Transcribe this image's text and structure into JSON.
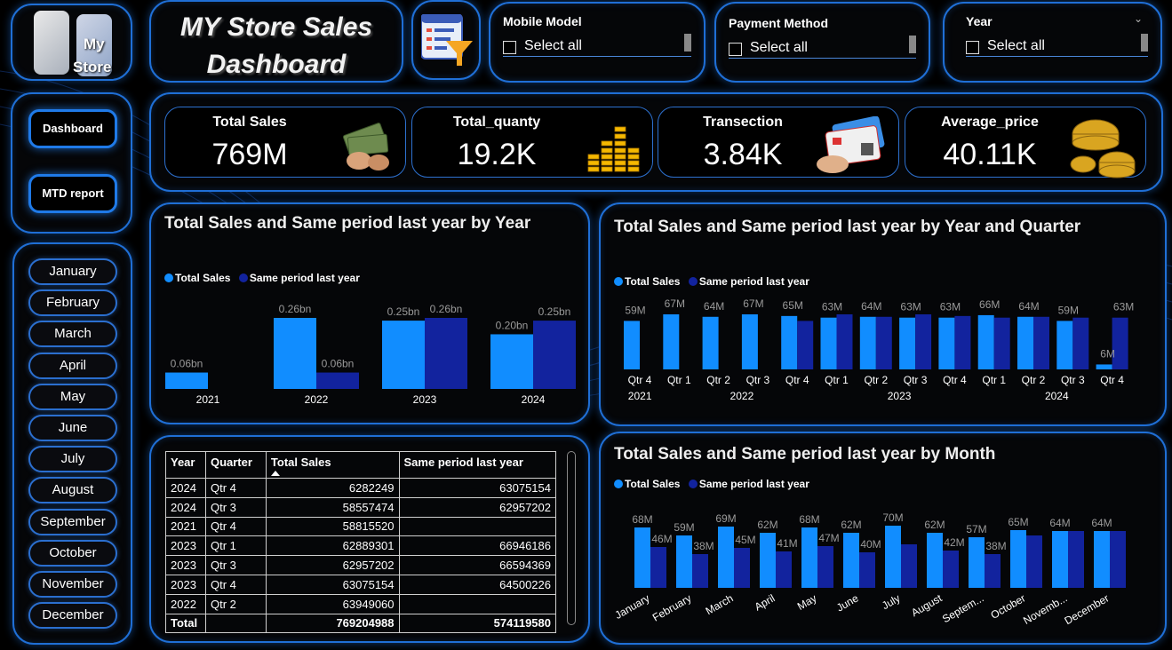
{
  "logo": {
    "text_line1": "My",
    "text_line2": "Store"
  },
  "header": {
    "title_line1": "MY Store Sales",
    "title_line2": "Dashboard"
  },
  "nav": {
    "dashboard": "Dashboard",
    "mtd_report": "MTD report"
  },
  "months": [
    "January",
    "February",
    "March",
    "April",
    "May",
    "June",
    "July",
    "August",
    "September",
    "October",
    "November",
    "December"
  ],
  "slicers": [
    {
      "title": "Mobile Model",
      "option": "Select all"
    },
    {
      "title": "Payment Method",
      "option": "Select all"
    },
    {
      "title": "Year",
      "option": "Select all"
    }
  ],
  "kpis": [
    {
      "label": "Total Sales",
      "value": "769M",
      "icon": "cash-icon"
    },
    {
      "label": "Total_quanty",
      "value": "19.2K",
      "icon": "coin-stack-chart-icon"
    },
    {
      "label": "Transection",
      "value": "3.84K",
      "icon": "credit-card-icon"
    },
    {
      "label": "Average_price",
      "value": "40.11K",
      "icon": "gold-coins-icon"
    }
  ],
  "legend": {
    "series1": "Total Sales",
    "series2": "Same period last year"
  },
  "colors": {
    "series1": "#118dff",
    "series2": "#12239e",
    "accent": "#1f6fd6"
  },
  "charts": {
    "by_year_title": "Total Sales and Same period last year by Year",
    "by_quarter_title": "Total Sales and Same period last year by Year and Quarter",
    "by_month_title": "Total Sales and Same period last year by Month"
  },
  "chart_data": [
    {
      "type": "bar",
      "title": "Total Sales and Same period last year by Year",
      "categories": [
        "2021",
        "2022",
        "2023",
        "2024"
      ],
      "series": [
        {
          "name": "Total Sales",
          "values": [
            0.06,
            0.26,
            0.25,
            0.2
          ],
          "labels": [
            "0.06bn",
            "0.26bn",
            "0.25bn",
            "0.20bn"
          ]
        },
        {
          "name": "Same period last year",
          "values": [
            null,
            0.06,
            0.26,
            0.25
          ],
          "labels": [
            "",
            "0.06bn",
            "0.26bn",
            "0.25bn"
          ]
        }
      ],
      "ylim": [
        0,
        0.26
      ]
    },
    {
      "type": "bar",
      "title": "Total Sales and Same period last year by Year and Quarter",
      "categories": [
        "Qtr 4",
        "Qtr 1",
        "Qtr 2",
        "Qtr 3",
        "Qtr 4",
        "Qtr 1",
        "Qtr 2",
        "Qtr 3",
        "Qtr 4",
        "Qtr 1",
        "Qtr 2",
        "Qtr 3",
        "Qtr 4"
      ],
      "groups": [
        {
          "label": "2021",
          "span": 1
        },
        {
          "label": "2022",
          "span": 4
        },
        {
          "label": "2023",
          "span": 4
        },
        {
          "label": "2024",
          "span": 4
        }
      ],
      "series": [
        {
          "name": "Total Sales",
          "values": [
            59,
            67,
            64,
            67,
            65,
            63,
            64,
            63,
            63,
            66,
            64,
            59,
            6
          ]
        },
        {
          "name": "Same period last year",
          "values": [
            null,
            null,
            null,
            null,
            59,
            67,
            64,
            67,
            65,
            63,
            64,
            63,
            63
          ]
        }
      ],
      "labels": [
        "59M",
        "67M",
        "64M",
        "67M",
        "65M",
        "63M",
        "64M",
        "63M",
        "63M",
        "66M",
        "64M",
        "59M",
        "6M",
        "63M"
      ],
      "ylim": [
        0,
        67
      ]
    },
    {
      "type": "bar",
      "title": "Total Sales and Same period last year by Month",
      "categories": [
        "January",
        "February",
        "March",
        "April",
        "May",
        "June",
        "July",
        "August",
        "Septem...",
        "October",
        "Novemb...",
        "December"
      ],
      "series": [
        {
          "name": "Total Sales",
          "values": [
            68,
            59,
            69,
            62,
            68,
            62,
            70,
            62,
            57,
            65,
            64,
            64
          ],
          "labels": [
            "68M",
            "59M",
            "69M",
            "62M",
            "68M",
            "62M",
            "70M",
            "62M",
            "57M",
            "65M",
            "64M",
            "64M"
          ]
        },
        {
          "name": "Same period last year",
          "values": [
            46,
            38,
            45,
            41,
            47,
            40,
            49,
            42,
            38,
            59,
            64,
            64
          ],
          "labels": [
            "46M",
            "38M",
            "45M",
            "41M",
            "47M",
            "40M",
            "",
            "42M",
            "38M",
            "",
            "",
            ""
          ]
        }
      ],
      "ylim": [
        0,
        70
      ]
    }
  ],
  "table": {
    "headers": [
      "Year",
      "Quarter",
      "Total Sales",
      "Same period last year"
    ],
    "rows": [
      [
        "2024",
        "Qtr 4",
        "6282249",
        "63075154"
      ],
      [
        "2024",
        "Qtr 3",
        "58557474",
        "62957202"
      ],
      [
        "2021",
        "Qtr 4",
        "58815520",
        ""
      ],
      [
        "2023",
        "Qtr 1",
        "62889301",
        "66946186"
      ],
      [
        "2023",
        "Qtr 3",
        "62957202",
        "66594369"
      ],
      [
        "2023",
        "Qtr 4",
        "63075154",
        "64500226"
      ],
      [
        "2022",
        "Qtr 2",
        "63949060",
        ""
      ]
    ],
    "total": [
      "Total",
      "",
      "769204988",
      "574119580"
    ]
  }
}
